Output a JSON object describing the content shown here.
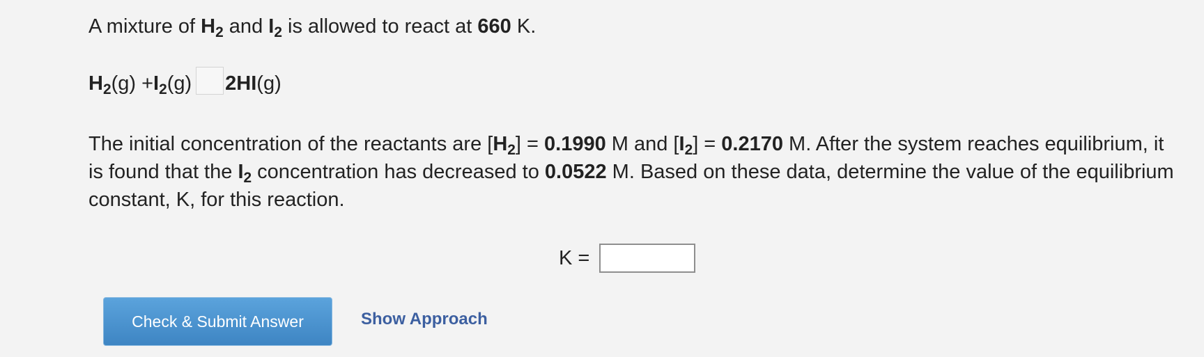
{
  "intro": {
    "part1": "A mixture of ",
    "h2_main": "H",
    "h2_sub": "2",
    "and": " and ",
    "i2_main": "I",
    "i2_sub": "2",
    "part2": " is allowed to react at ",
    "temp": "660",
    "unit": " K."
  },
  "reaction": {
    "h2_main": "H",
    "h2_sub": "2",
    "h2_state": "(g) + ",
    "i2_main": "I",
    "i2_sub": "2",
    "i2_state": "(g)",
    "product_main": "2HI",
    "product_state": "(g)"
  },
  "paragraph": {
    "t1": "The initial concentration of the reactants are [",
    "h2_main": "H",
    "h2_sub": "2",
    "t2": "] = ",
    "h2_conc": "0.1990",
    "t3": " M and [",
    "i2_main": "I",
    "i2_sub": "2",
    "t4": "] = ",
    "i2_conc": "0.2170",
    "t5": " M. After the system reaches equilibrium, it is found that the ",
    "i2b_main": "I",
    "i2b_sub": "2",
    "t6": " concentration has decreased to ",
    "eq_conc": "0.0522",
    "t7": " M. Based on these data, determine the value of the equilibrium constant, K, for this reaction."
  },
  "answer": {
    "k_label": "K =",
    "k_value": ""
  },
  "buttons": {
    "submit_label": "Check & Submit Answer",
    "approach_label": "Show Approach"
  }
}
